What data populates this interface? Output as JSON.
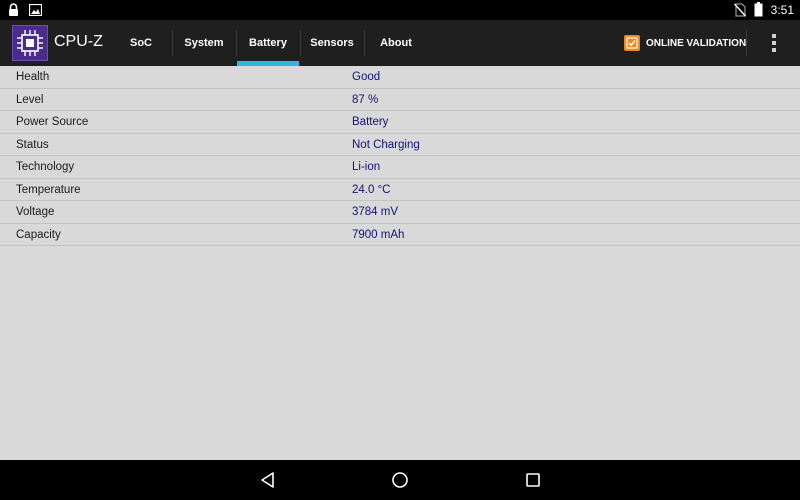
{
  "status_bar": {
    "left_icons": [
      "lock-icon",
      "image-icon"
    ],
    "right_icons": [
      "no-sim-icon",
      "battery-icon"
    ],
    "time": "3:51"
  },
  "app_bar": {
    "title": "CPU-Z",
    "logo_icon": "cpu-chip-icon",
    "tabs": [
      {
        "label": "SoC",
        "active": false
      },
      {
        "label": "System",
        "active": false
      },
      {
        "label": "Battery",
        "active": true
      },
      {
        "label": "Sensors",
        "active": false
      },
      {
        "label": "About",
        "active": false
      }
    ],
    "validation_label": "ONLINE VALIDATION",
    "validation_icon": "validation-badge-icon",
    "overflow_icon": "overflow-menu-icon"
  },
  "battery": {
    "rows": [
      {
        "label": "Health",
        "value": "Good"
      },
      {
        "label": "Level",
        "value": "87 %"
      },
      {
        "label": "Power Source",
        "value": "Battery"
      },
      {
        "label": "Status",
        "value": "Not Charging"
      },
      {
        "label": "Technology",
        "value": "Li-ion"
      },
      {
        "label": "Temperature",
        "value": "24.0 °C"
      },
      {
        "label": "Voltage",
        "value": "3784 mV"
      },
      {
        "label": "Capacity",
        "value": "7900 mAh"
      }
    ]
  },
  "nav_bar": {
    "icons": [
      "back-icon",
      "home-icon",
      "recents-icon"
    ]
  },
  "colors": {
    "accent": "#33b5e5",
    "app_bar_bg": "#1f1f1f",
    "content_bg": "#d9d9d9",
    "value_text": "#12127a",
    "validation_orange": "#f0891f",
    "logo_purple": "#4a2c8c"
  }
}
